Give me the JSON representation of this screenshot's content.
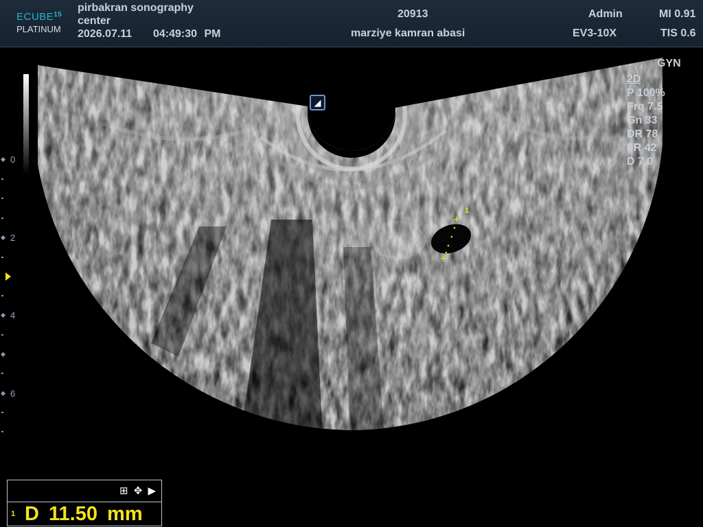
{
  "header": {
    "logo_line1": "ECUBE",
    "logo_num": "15",
    "logo_line2": "PLATINUM",
    "hospital_line1": "pirbakran sonography",
    "hospital_line2": "center",
    "date": "2026.07.11",
    "time": "04:49:30 PM",
    "patient_id": "20913",
    "patient_name": "marziye kamran abasi",
    "user": "Admin",
    "probe": "EV3-10X",
    "mi": "MI 0.91",
    "tis": "TIS 0.6"
  },
  "preset": "GYN",
  "params": {
    "mode": "2D",
    "power": "P 100%",
    "freq": "Frq 7.5",
    "gain": "Gn 33",
    "dynamic_range": "DR 78",
    "frame_rate": "FR 42",
    "depth": "D 7.0"
  },
  "depth_scale": {
    "labels": [
      "0",
      "2",
      "4",
      "6"
    ]
  },
  "orientation_marker": "◢",
  "measurement": {
    "caliper_label": "1",
    "result_index": "1",
    "result_text": "D 11.50 mm",
    "panel_icons": "⊞ ✥ ▶"
  },
  "colors": {
    "caliper": "#f4e219",
    "header_bg": "#1d2b3b",
    "logo_accent": "#24b6c8"
  }
}
